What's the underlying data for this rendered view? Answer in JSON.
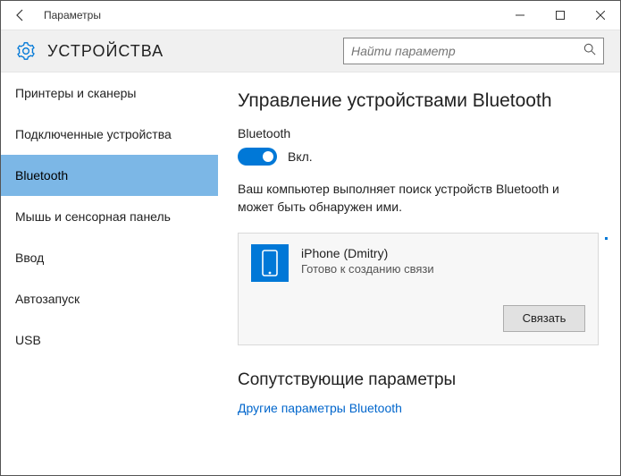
{
  "window": {
    "title": "Параметры"
  },
  "header": {
    "section": "УСТРОЙСТВА"
  },
  "search": {
    "placeholder": "Найти параметр"
  },
  "sidebar": {
    "items": [
      {
        "label": "Принтеры и сканеры"
      },
      {
        "label": "Подключенные устройства"
      },
      {
        "label": "Bluetooth"
      },
      {
        "label": "Мышь и сенсорная панель"
      },
      {
        "label": "Ввод"
      },
      {
        "label": "Автозапуск"
      },
      {
        "label": "USB"
      }
    ],
    "selected_index": 2
  },
  "main": {
    "title": "Управление устройствами Bluetooth",
    "toggle_label": "Bluetooth",
    "toggle_state": "Вкл.",
    "toggle_on": true,
    "description": "Ваш компьютер выполняет поиск устройств Bluetooth и может быть обнаружен ими.",
    "device": {
      "name": "iPhone (Dmitry)",
      "status": "Готово к созданию связи",
      "action": "Связать"
    },
    "related": {
      "heading": "Сопутствующие параметры",
      "link": "Другие параметры Bluetooth"
    }
  }
}
